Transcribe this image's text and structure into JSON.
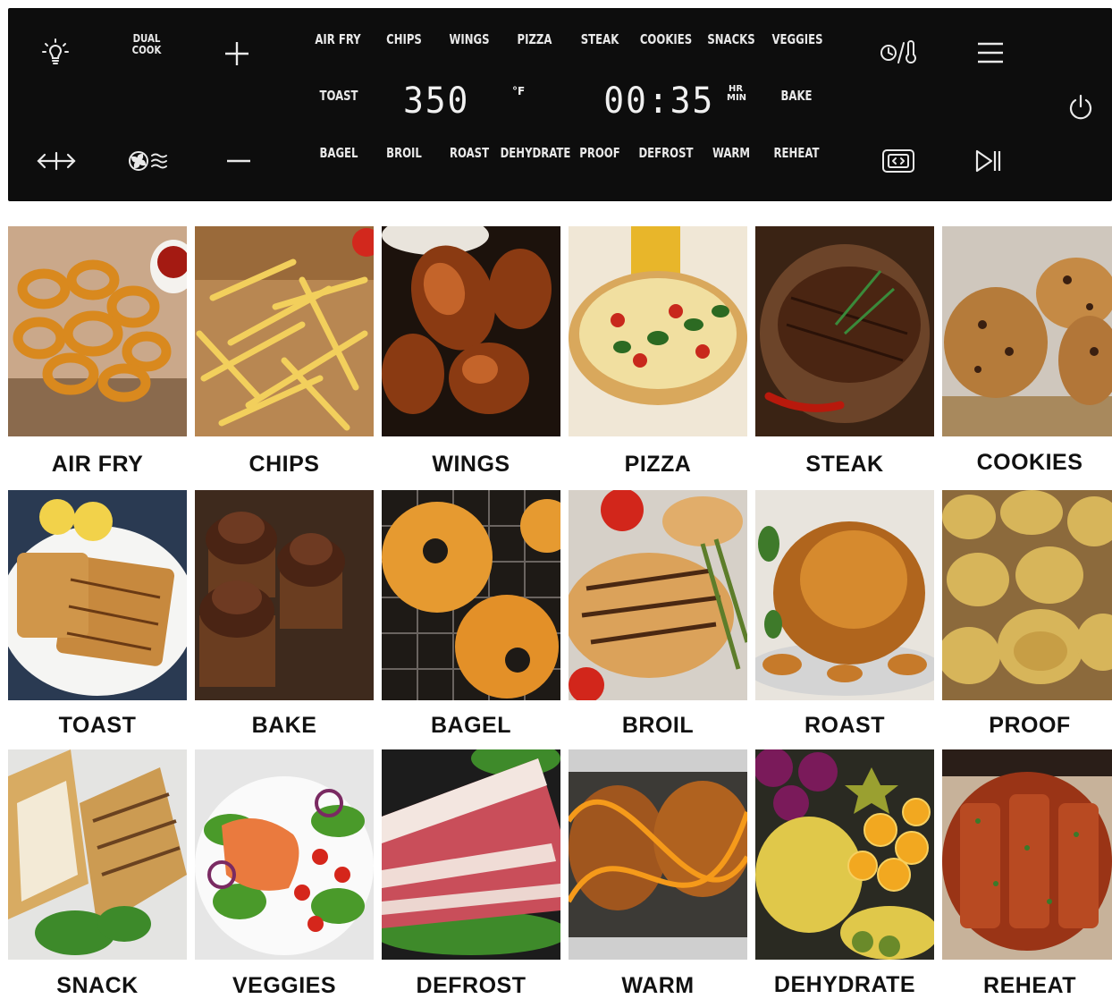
{
  "panel": {
    "dual_cook": [
      "DUAL",
      "COOK"
    ],
    "modes_top": [
      "AIR FRY",
      "CHIPS",
      "WINGS",
      "PIZZA",
      "STEAK",
      "COOKIES",
      "SNACKS",
      "VEGGIES"
    ],
    "modes_middle_left": "TOAST",
    "modes_middle_right": "BAKE",
    "modes_bottom": [
      "BAGEL",
      "BROIL",
      "ROAST",
      "DEHYDRATE",
      "PROOF",
      "DEFROST",
      "WARM",
      "REHEAT"
    ],
    "temperature": "350",
    "temperature_unit": "°F",
    "time": "00:35",
    "time_unit_top": "HR",
    "time_unit_bottom": "MIN",
    "icons": {
      "light": "light-bulb-icon",
      "plus": "plus-icon",
      "minus": "minus-icon",
      "rotate": "rotisserie-arrows-icon",
      "fan": "convection-fan-icon",
      "timer_temp": "timer-thermometer-icon",
      "menu": "menu-icon",
      "power": "power-icon",
      "oven": "oven-light-icon",
      "play_pause": "play-pause-icon"
    }
  },
  "grid": {
    "rows": [
      [
        "AIR FRY",
        "CHIPS",
        "WINGS",
        "PIZZA",
        "STEAK",
        "COOKIES"
      ],
      [
        "TOAST",
        "BAKE",
        "BAGEL",
        "BROIL",
        "ROAST",
        "PROOF"
      ],
      [
        "SNACK",
        "VEGGIES",
        "DEFROST",
        "WARM",
        "DEHYDRATE",
        "REHEAT"
      ]
    ]
  }
}
